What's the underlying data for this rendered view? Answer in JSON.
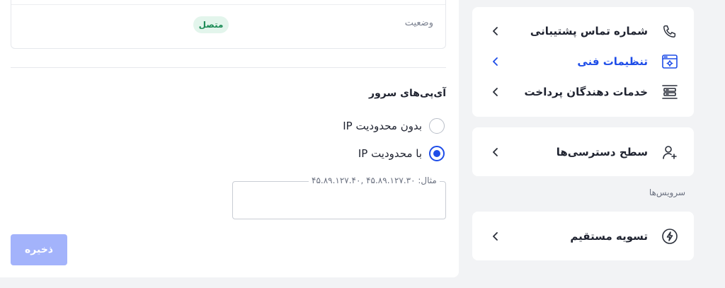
{
  "status": {
    "label": "وضعیت",
    "value": "متصل",
    "badge_color": "#1b8a55"
  },
  "server_ips": {
    "title": "آی‌پی‌های سرور",
    "options": [
      {
        "label": "بدون محدودیت IP",
        "checked": false
      },
      {
        "label": "با محدودیت IP",
        "checked": true
      }
    ],
    "field_label": "مثال: ۴۵.۸۹.۱۲۷.۳۰ ,۴۵.۸۹.۱۲۷.۴۰",
    "field_value": ""
  },
  "save_label": "ذخیره",
  "sidebar": {
    "items": [
      {
        "label": "شماره تماس پشتیبانی",
        "icon": "phone-icon"
      },
      {
        "label": "تنظیمات فنی",
        "icon": "browser-settings-icon",
        "active": true
      },
      {
        "label": "خدمات دهندگان پرداخت",
        "icon": "server-stack-icon"
      }
    ],
    "access": {
      "label": "سطح دسترسی‌ها",
      "icon": "user-plus-icon"
    },
    "services_heading": "سرویس‌ها",
    "services": [
      {
        "label": "تسویه مستقیم",
        "icon": "lightning-icon"
      }
    ]
  },
  "colors": {
    "accent": "#1e4de8",
    "save_button": "#a3b3fb",
    "background": "#f2f3f5"
  }
}
